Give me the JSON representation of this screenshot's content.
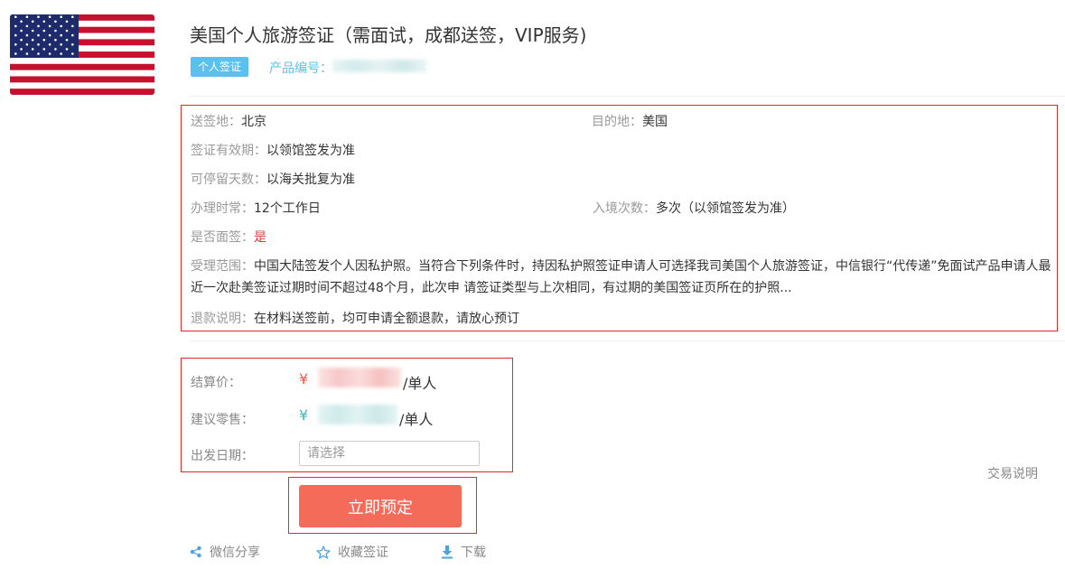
{
  "product": {
    "title": "美国个人旅游签证（需面试，成都送签，VIP服务)",
    "tag": "个人签证",
    "product_no_label": "产品编号："
  },
  "info": {
    "send_place": {
      "label": "送签地：",
      "value": "北京"
    },
    "destination": {
      "label": "目的地：",
      "value": "美国"
    },
    "validity": {
      "label": "签证有效期：",
      "value": "以领馆签发为准"
    },
    "stay_days": {
      "label": "可停留天数：",
      "value": "以海关批复为准"
    },
    "processing": {
      "label": "办理时常：",
      "value": "12个工作日"
    },
    "entries": {
      "label": "入境次数：",
      "value": "多次（以领馆签发为准）"
    },
    "interview": {
      "label": "是否面签：",
      "value": "是"
    },
    "scope": {
      "label": "受理范围：",
      "value": "中国大陆签发个人因私护照。当符合下列条件时，持因私护照签证申请人可选择我司美国个人旅游签证，中信银行“代传递”免面试产品申请人最近一次赴美签证过期时间不超过48个月，此次申 请签证类型与上次相同，有过期的美国签证页所在的护照..."
    },
    "refund": {
      "label": "退款说明：",
      "value": "在材料送签前，均可申请全额退款，请放心预订"
    }
  },
  "pricing": {
    "settle_label": "结算价：",
    "retail_label": "建议零售：",
    "date_label": "出发日期：",
    "currency": "¥",
    "per_unit": "/单人",
    "date_placeholder": "请选择"
  },
  "trade_note": "交易说明",
  "book_label": "立即预定",
  "actions": {
    "share": "微信分享",
    "favorite": "收藏签证",
    "download": "下载"
  },
  "colors": {
    "accent_blue": "#5bc0eb",
    "book_button": "#f46b5a",
    "highlight_border": "#e32b2b"
  }
}
